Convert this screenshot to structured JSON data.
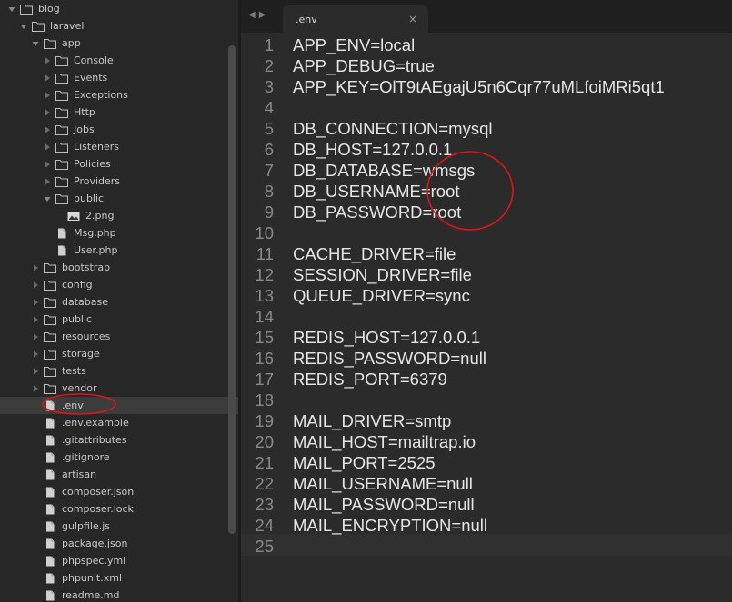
{
  "sidebar": {
    "items": [
      {
        "label": "blog",
        "type": "folder",
        "depth": 0,
        "expanded": true
      },
      {
        "label": "laravel",
        "type": "folder",
        "depth": 1,
        "expanded": true
      },
      {
        "label": "app",
        "type": "folder",
        "depth": 2,
        "expanded": true
      },
      {
        "label": "Console",
        "type": "folder",
        "depth": 3,
        "expanded": false
      },
      {
        "label": "Events",
        "type": "folder",
        "depth": 3,
        "expanded": false
      },
      {
        "label": "Exceptions",
        "type": "folder",
        "depth": 3,
        "expanded": false
      },
      {
        "label": "Http",
        "type": "folder",
        "depth": 3,
        "expanded": false
      },
      {
        "label": "Jobs",
        "type": "folder",
        "depth": 3,
        "expanded": false
      },
      {
        "label": "Listeners",
        "type": "folder",
        "depth": 3,
        "expanded": false
      },
      {
        "label": "Policies",
        "type": "folder",
        "depth": 3,
        "expanded": false
      },
      {
        "label": "Providers",
        "type": "folder",
        "depth": 3,
        "expanded": false
      },
      {
        "label": "public",
        "type": "folder",
        "depth": 3,
        "expanded": true
      },
      {
        "label": "2.png",
        "type": "image",
        "depth": 4
      },
      {
        "label": "Msg.php",
        "type": "file",
        "depth": 3
      },
      {
        "label": "User.php",
        "type": "file",
        "depth": 3
      },
      {
        "label": "bootstrap",
        "type": "folder",
        "depth": 2,
        "expanded": false
      },
      {
        "label": "config",
        "type": "folder",
        "depth": 2,
        "expanded": false
      },
      {
        "label": "database",
        "type": "folder",
        "depth": 2,
        "expanded": false
      },
      {
        "label": "public",
        "type": "folder",
        "depth": 2,
        "expanded": false
      },
      {
        "label": "resources",
        "type": "folder",
        "depth": 2,
        "expanded": false
      },
      {
        "label": "storage",
        "type": "folder",
        "depth": 2,
        "expanded": false
      },
      {
        "label": "tests",
        "type": "folder",
        "depth": 2,
        "expanded": false
      },
      {
        "label": "vendor",
        "type": "folder",
        "depth": 2,
        "expanded": false
      },
      {
        "label": ".env",
        "type": "file",
        "depth": 2,
        "selected": true
      },
      {
        "label": ".env.example",
        "type": "file",
        "depth": 2
      },
      {
        "label": ".gitattributes",
        "type": "file",
        "depth": 2
      },
      {
        "label": ".gitignore",
        "type": "file",
        "depth": 2
      },
      {
        "label": "artisan",
        "type": "file",
        "depth": 2
      },
      {
        "label": "composer.json",
        "type": "file",
        "depth": 2
      },
      {
        "label": "composer.lock",
        "type": "file",
        "depth": 2
      },
      {
        "label": "gulpfile.js",
        "type": "file",
        "depth": 2
      },
      {
        "label": "package.json",
        "type": "file",
        "depth": 2
      },
      {
        "label": "phpspec.yml",
        "type": "file",
        "depth": 2
      },
      {
        "label": "phpunit.xml",
        "type": "file",
        "depth": 2
      },
      {
        "label": "readme.md",
        "type": "file",
        "depth": 2
      }
    ]
  },
  "tabs": [
    {
      "label": ".env",
      "close_glyph": "×",
      "active": true
    }
  ],
  "nav": {
    "back_glyph": "◀",
    "forward_glyph": "▶"
  },
  "editor": {
    "current_line": 25,
    "lines": [
      "APP_ENV=local",
      "APP_DEBUG=true",
      "APP_KEY=OlT9tAEgajU5n6Cqr77uMLfoiMRi5qt1",
      "",
      "DB_CONNECTION=mysql",
      "DB_HOST=127.0.0.1",
      "DB_DATABASE=wmsgs",
      "DB_USERNAME=root",
      "DB_PASSWORD=root",
      "",
      "CACHE_DRIVER=file",
      "SESSION_DRIVER=file",
      "QUEUE_DRIVER=sync",
      "",
      "REDIS_HOST=127.0.0.1",
      "REDIS_PASSWORD=null",
      "REDIS_PORT=6379",
      "",
      "MAIL_DRIVER=smtp",
      "MAIL_HOST=mailtrap.io",
      "MAIL_PORT=2525",
      "MAIL_USERNAME=null",
      "MAIL_PASSWORD=null",
      "MAIL_ENCRYPTION=null",
      ""
    ]
  },
  "colors": {
    "sidebar_bg": "#272727",
    "editor_bg": "#2b2b2b",
    "text": "#e6e6e6",
    "gutter_text": "#8a8a8a",
    "annotation_red": "#e01515"
  }
}
